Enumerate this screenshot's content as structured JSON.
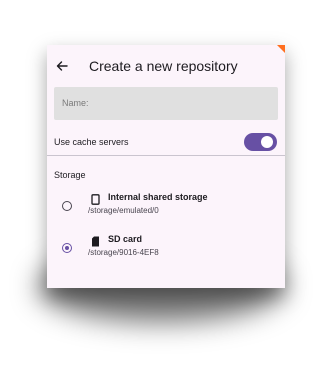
{
  "appbar": {
    "title": "Create a new repository",
    "back_icon": "arrow-left-icon"
  },
  "name_field": {
    "label": "Name:",
    "value": ""
  },
  "cache": {
    "label": "Use cache servers",
    "enabled": true
  },
  "storage": {
    "label": "Storage",
    "options": [
      {
        "title": "Internal shared storage",
        "path": "/storage/emulated/0",
        "icon": "phone-icon",
        "selected": false
      },
      {
        "title": "SD card",
        "path": "/storage/9016-4EF8",
        "icon": "sd-card-icon",
        "selected": true
      }
    ]
  },
  "colors": {
    "accent": "#6750a4",
    "background": "#fcf4fb",
    "field": "#e0e0e0",
    "corner_badge": "#ff6f1f"
  }
}
